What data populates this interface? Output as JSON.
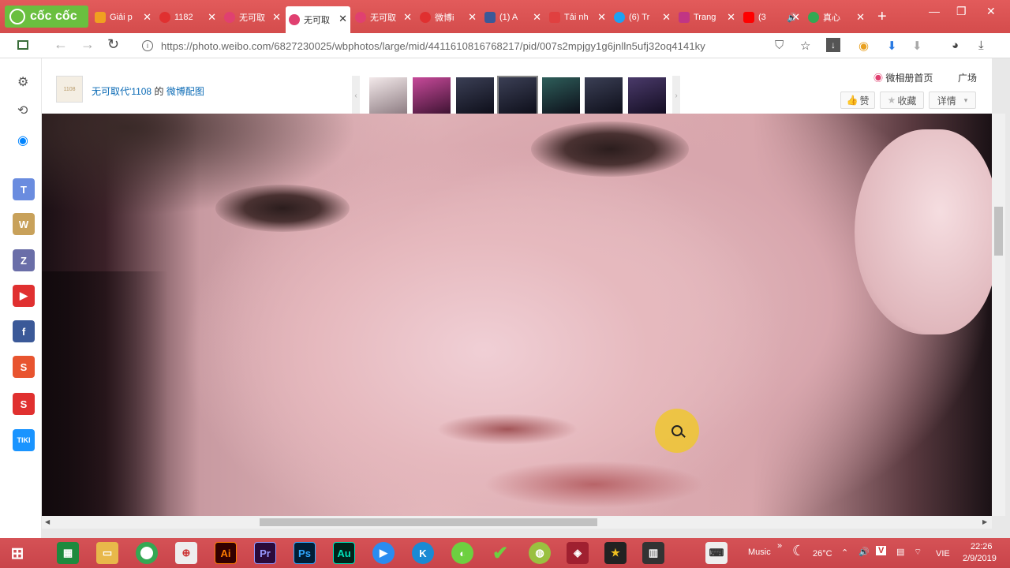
{
  "browser": {
    "brand": "cốc cốc",
    "tabs": [
      {
        "label": "Giải p",
        "color": "#f0a020"
      },
      {
        "label": "1182",
        "color": "#e03030"
      },
      {
        "label": "无可取",
        "color": "#e04070"
      },
      {
        "label": "无可取",
        "color": "#e04070",
        "active": true
      },
      {
        "label": "无可取",
        "color": "#e04070"
      },
      {
        "label": "微博i",
        "color": "#e03030"
      },
      {
        "label": "(1) A",
        "color": "#3b5998"
      },
      {
        "label": "Tải nh",
        "color": "#e04040"
      },
      {
        "label": "(6) Tr",
        "color": "#1da1f2"
      },
      {
        "label": "Trang",
        "color": "#c13584"
      },
      {
        "label": "(3",
        "color": "#ff0000"
      },
      {
        "label": "真心",
        "color": "#34a853"
      }
    ],
    "url": "https://photo.weibo.com/6827230025/wbphotos/large/mid/4411610816768217/pid/007s2mpjgy1g6jnlln5ufj32oq4141ky"
  },
  "sidebar": {
    "items": [
      {
        "label": "T",
        "color": "#6a8cdf"
      },
      {
        "label": "W",
        "color": "#c8a15a"
      },
      {
        "label": "Z",
        "color": "#6a6ea8"
      },
      {
        "label": "▶",
        "color": "#e03030"
      },
      {
        "label": "f",
        "color": "#3b5998"
      },
      {
        "label": "S",
        "color": "#e8542f"
      },
      {
        "label": "S",
        "color": "#e0302f"
      },
      {
        "label": "TIKI",
        "color": "#1a94ff"
      }
    ]
  },
  "photo_header": {
    "avatar_text": "1108",
    "user_name": "无可取代'1108",
    "de": "的",
    "album_link": "微博配图",
    "home_link": "微相册首页",
    "plaza_link": "广场",
    "like_button": "赞",
    "collect_button": "收藏",
    "details_button": "详情"
  },
  "taskbar": {
    "apps": [
      {
        "label": "Ai",
        "color": "#ff7c00"
      },
      {
        "label": "Pr",
        "color": "#9999ff"
      },
      {
        "label": "Ps",
        "color": "#31a8ff"
      },
      {
        "label": "Au",
        "color": "#00e4bb"
      }
    ],
    "music_label": "Music",
    "temperature": "26°C",
    "lang": "VIE",
    "time": "22:26",
    "date": "2/9/2019"
  }
}
